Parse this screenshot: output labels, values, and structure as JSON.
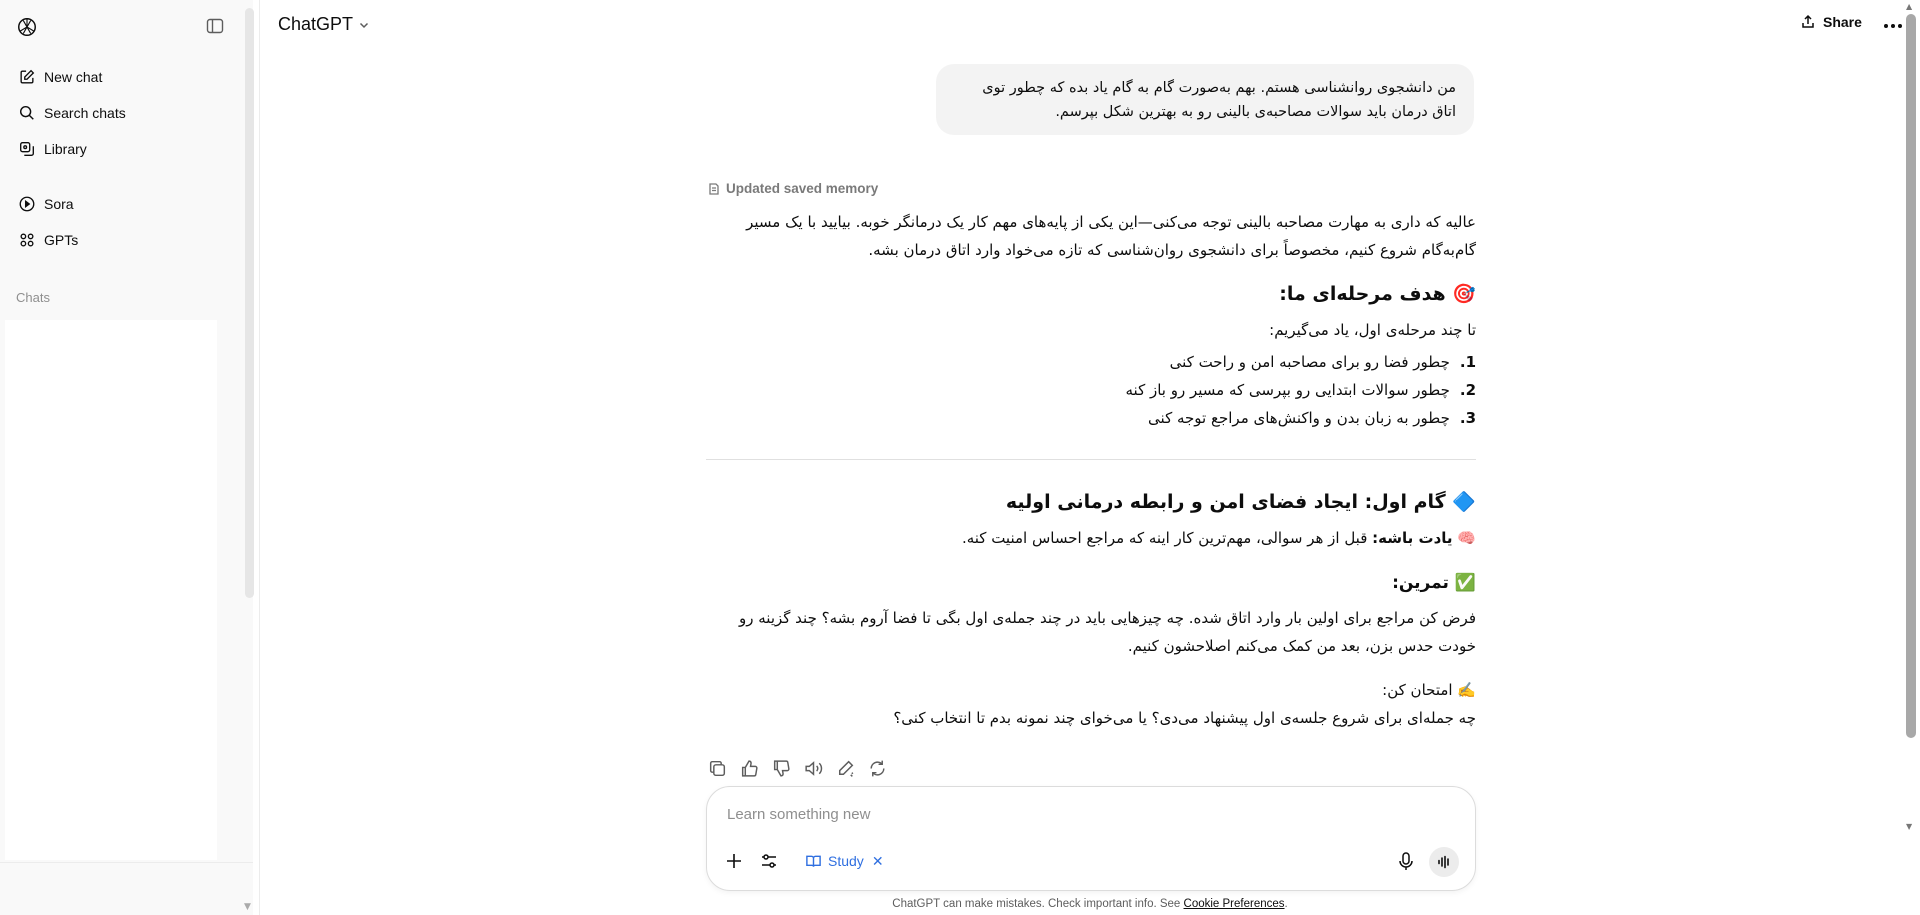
{
  "sidebar": {
    "items": [
      {
        "label": "New chat",
        "icon": "edit-icon"
      },
      {
        "label": "Search chats",
        "icon": "search-icon"
      },
      {
        "label": "Library",
        "icon": "library-icon"
      }
    ],
    "items2": [
      {
        "label": "Sora",
        "icon": "play-circle-icon"
      },
      {
        "label": "GPTs",
        "icon": "grid-icon"
      }
    ],
    "chats_label": "Chats"
  },
  "header": {
    "model": "ChatGPT",
    "share": "Share"
  },
  "conversation": {
    "user_message": "من دانشجوی روانشناسی هستم. بهم به‌صورت گام به گام یاد بده که چطور توی اتاق درمان باید سوالات مصاحبه‌ی بالینی رو به بهترین شکل بپرسم.",
    "memory_note": "Updated saved memory",
    "intro": "عالیه که داری به مهارت مصاحبه بالینی توجه می‌کنی—این یکی از پایه‌های مهم کار یک درمانگر خوبه. بیایید با یک مسیر گام‌به‌گام شروع کنیم، مخصوصاً برای دانشجوی روان‌شناسی که تازه می‌خواد وارد اتاق درمان بشه.",
    "goal_heading": "🎯 هدف مرحله‌ای ما:",
    "goal_intro": "تا چند مرحله‌ی اول، یاد می‌گیریم:",
    "goals": [
      {
        "num": "1.",
        "text": "چطور فضا رو برای مصاحبه امن و راحت کنی"
      },
      {
        "num": "2.",
        "text": "چطور سوالات ابتدایی رو بپرسی که مسیر رو باز کنه"
      },
      {
        "num": "3.",
        "text": "چطور به زبان بدن و واکنش‌های مراجع توجه کنی"
      }
    ],
    "step1_heading": "🔷 گام اول: ایجاد فضای امن و رابطه درمانی اولیه",
    "remember_emoji": "🧠",
    "remember_label": "یادت باشه:",
    "remember_text": " قبل از هر سوالی، مهم‌ترین کار اینه که مراجع احساس امنیت کنه.",
    "exercise_heading": "✅ تمرین:",
    "exercise_text": "فرض کن مراجع برای اولین بار وارد اتاق شده. چه چیزهایی باید در چند جمله‌ی اول بگی تا فضا آروم بشه؟ چند گزینه رو خودت حدس بزن، بعد من کمک می‌کنم اصلاحشون کنیم.",
    "try_label": "✍️ امتحان کن:",
    "try_question": "چه جمله‌ای برای شروع جلسه‌ی اول پیشنهاد می‌دی؟ یا می‌خوای چند نمونه بدم تا انتخاب کنی؟"
  },
  "composer": {
    "placeholder": "Learn something new",
    "study_label": "Study"
  },
  "footer": {
    "text": "ChatGPT can make mistakes. Check important info. See ",
    "link": "Cookie Preferences",
    "end": "."
  }
}
